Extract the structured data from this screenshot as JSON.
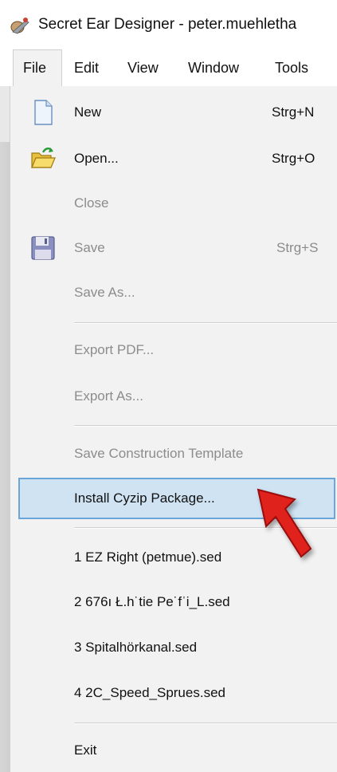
{
  "window": {
    "title": "Secret Ear Designer - peter.muehletha"
  },
  "menubar": {
    "items": [
      "File",
      "Edit",
      "View",
      "Window",
      "Tools"
    ],
    "active": "File"
  },
  "file_menu": {
    "items": [
      {
        "label": "New",
        "shortcut": "Strg+N",
        "icon": "new-file-icon",
        "enabled": true
      },
      {
        "label": "Open...",
        "shortcut": "Strg+O",
        "icon": "open-folder-icon",
        "enabled": true
      },
      {
        "label": "Close",
        "shortcut": "",
        "enabled": false
      },
      {
        "label": "Save",
        "shortcut": "Strg+S",
        "icon": "save-disk-icon",
        "enabled": false
      },
      {
        "label": "Save As...",
        "shortcut": "",
        "enabled": false
      },
      {
        "label": "Export PDF...",
        "shortcut": "",
        "enabled": false
      },
      {
        "label": "Export As...",
        "shortcut": "",
        "enabled": false
      },
      {
        "label": "Save Construction Template",
        "shortcut": "",
        "enabled": false
      },
      {
        "label": "Install Cyzip Package...",
        "shortcut": "",
        "enabled": true,
        "highlighted": true
      },
      {
        "label": "1 EZ Right (petmue).sed",
        "shortcut": "",
        "enabled": true
      },
      {
        "label": "2 676ı Ł.h˙tie Pe˙fˈi_L.sed",
        "shortcut": "",
        "enabled": true
      },
      {
        "label": "3 Spitalhörkanal.sed",
        "shortcut": "",
        "enabled": true
      },
      {
        "label": "4 2C_Speed_Sprues.sed",
        "shortcut": "",
        "enabled": true
      },
      {
        "label": "Exit",
        "shortcut": "",
        "enabled": true
      }
    ]
  },
  "colors": {
    "menu_bg": "#f2f2f2",
    "highlight_bg": "#cfe3f3",
    "highlight_border": "#6aa6d8",
    "disabled_text": "#8c8c8c",
    "cursor_red": "#e0201c"
  }
}
